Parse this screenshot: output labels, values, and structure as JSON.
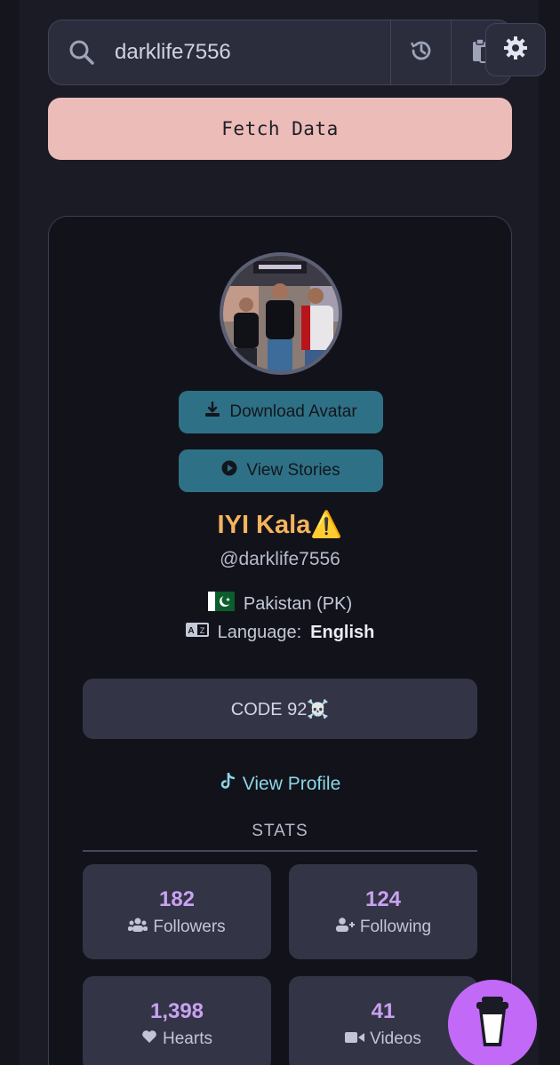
{
  "search": {
    "value": "darklife7556"
  },
  "buttons": {
    "fetch": "Fetch Data",
    "download_avatar": "Download Avatar",
    "view_stories": "View Stories"
  },
  "profile": {
    "name": "IYI Kala⚠️",
    "handle": "@darklife7556",
    "country_flag": "🇵🇰",
    "country": "Pakistan (PK)",
    "language_label": "Language:",
    "language": "English",
    "bio": "CODE 92☠️",
    "view_profile": "View Profile"
  },
  "stats": {
    "title": "STATS",
    "items": [
      {
        "value": "182",
        "label": "Followers"
      },
      {
        "value": "124",
        "label": "Following"
      },
      {
        "value": "1,398",
        "label": "Hearts"
      },
      {
        "value": "41",
        "label": "Videos"
      }
    ]
  },
  "colors": {
    "fetch_bg": "#ebbcb8",
    "button_bg": "#2e7186",
    "name": "#f5b35d",
    "stat_value": "#c9a2f0",
    "link": "#8ad6e5",
    "coffee": "#c26af7"
  },
  "icons": [
    "search-icon",
    "history-icon",
    "clipboard-icon",
    "gear-icon",
    "download-icon",
    "play-icon",
    "tiktok-icon",
    "users-icon",
    "user-plus-icon",
    "heart-icon",
    "video-icon",
    "coffee-cup-icon",
    "translate-icon"
  ]
}
